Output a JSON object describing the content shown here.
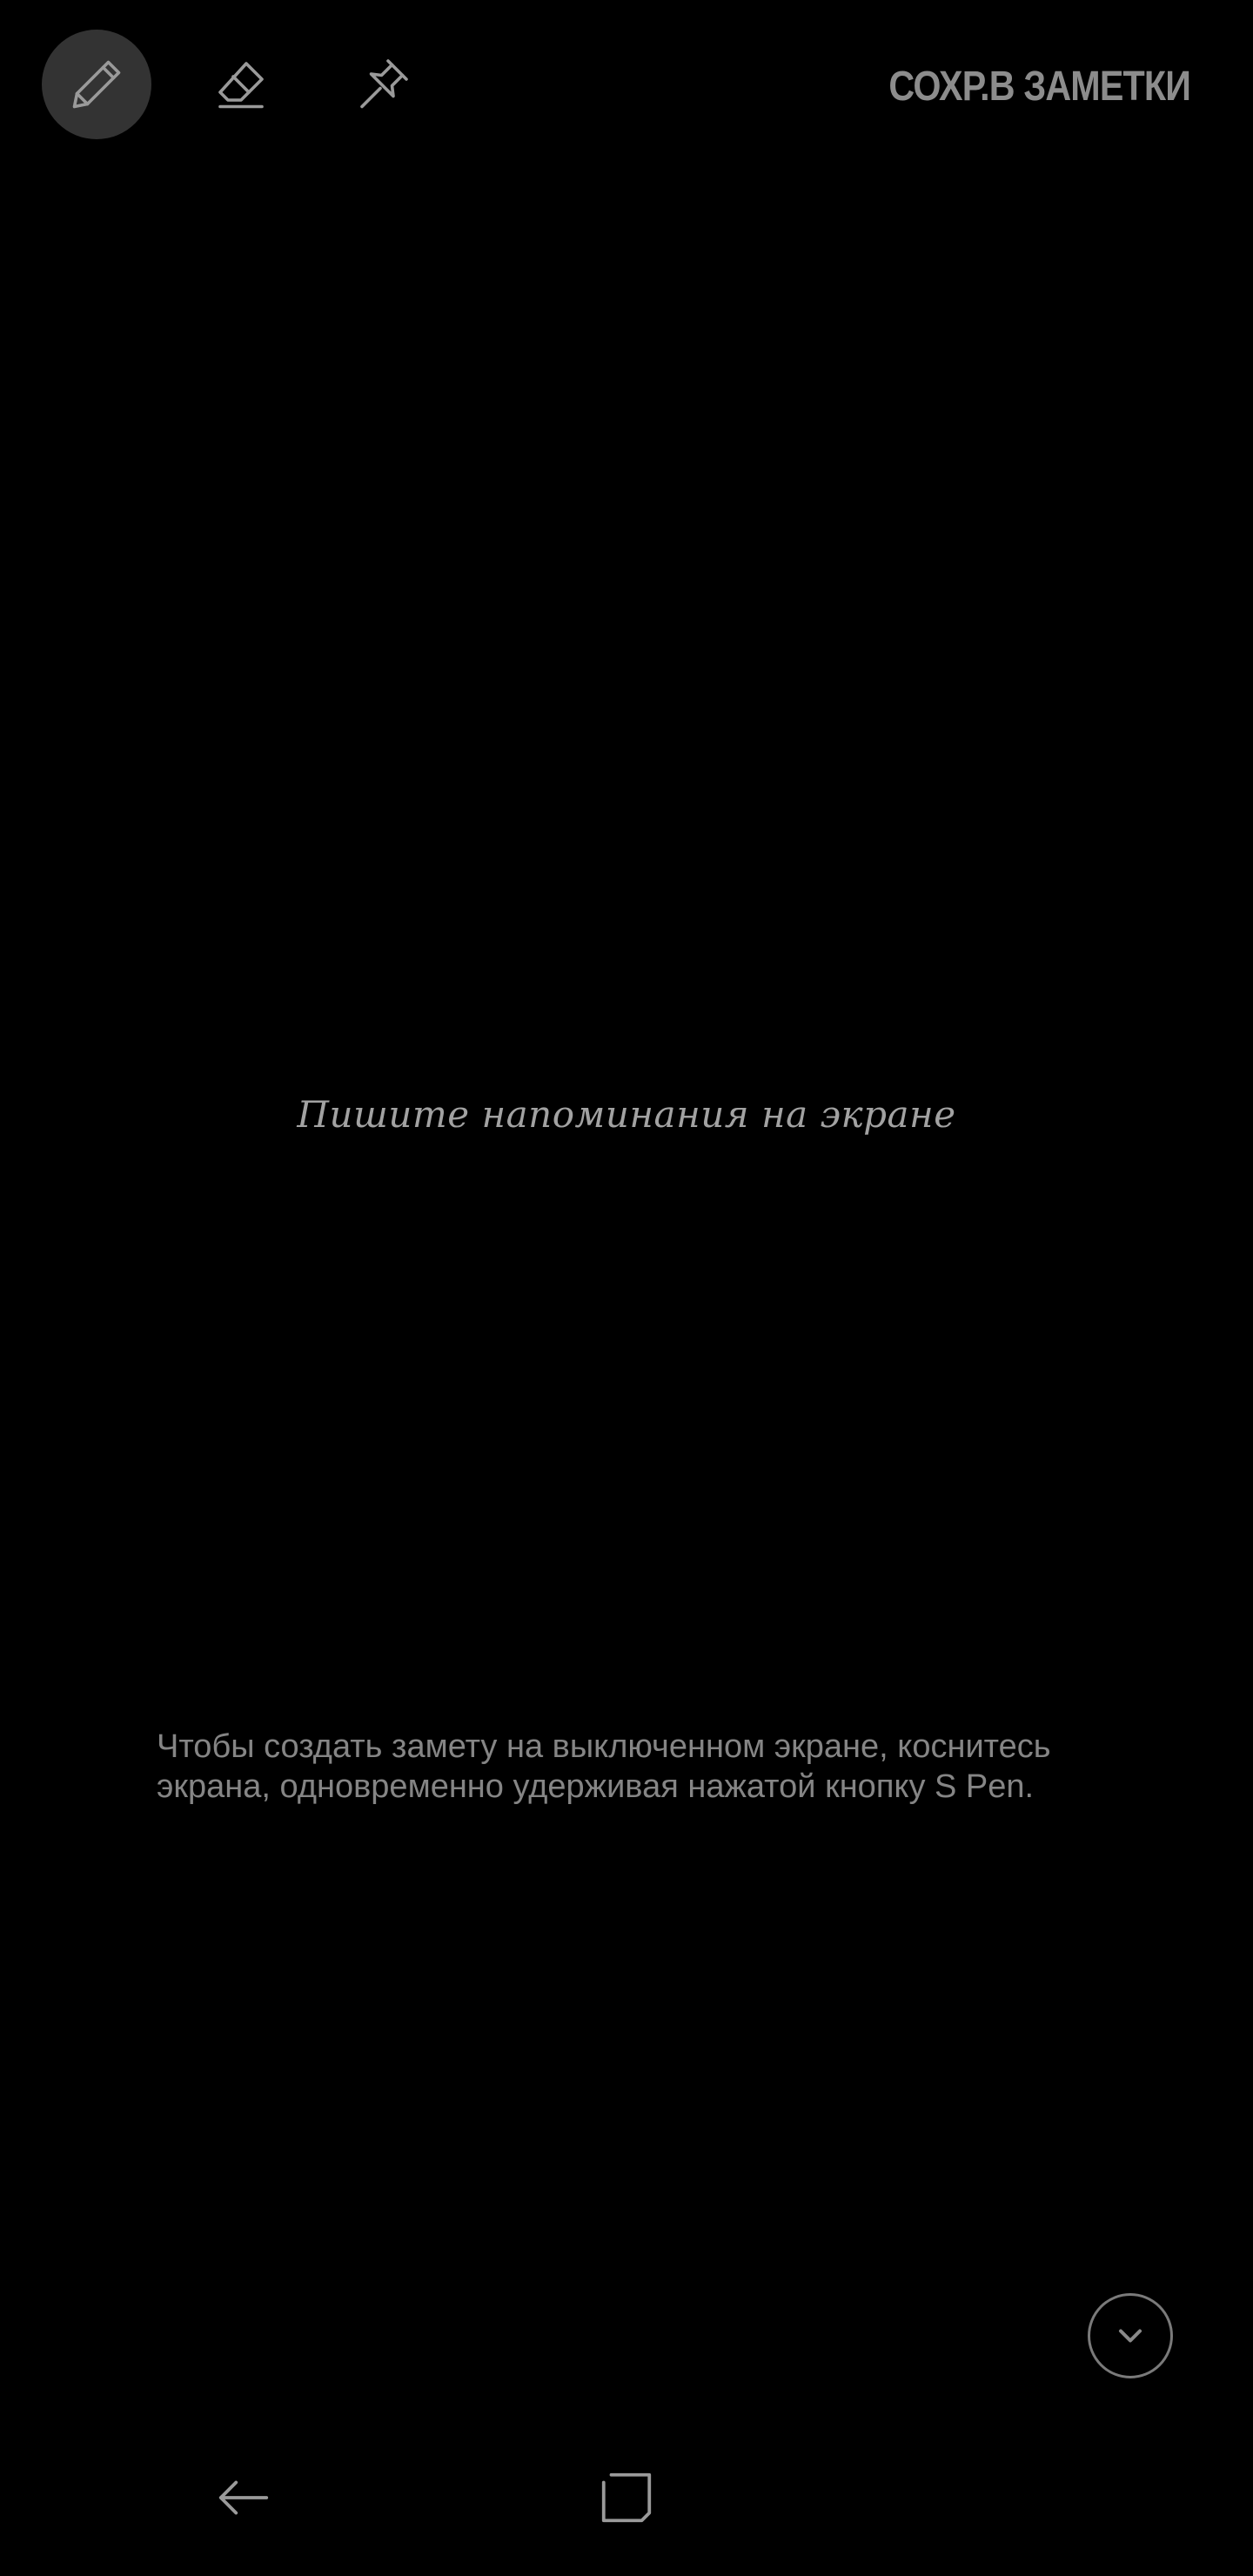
{
  "toolbar": {
    "tools": [
      {
        "name": "pen",
        "icon": "pen-icon",
        "active": true
      },
      {
        "name": "eraser",
        "icon": "eraser-icon",
        "active": false
      },
      {
        "name": "pin",
        "icon": "pin-icon",
        "active": false
      }
    ],
    "save_label": "СОХР.В ЗАМЕТКИ"
  },
  "canvas": {
    "placeholder": "Пишите напоминания на экране",
    "info": "Чтобы создать замету на выключенном экране, коснитесь экрана, одновременно удерживая нажатой кнопку S Pen."
  },
  "controls": {
    "collapse_icon": "chevron-down-icon"
  },
  "navbar": {
    "back_icon": "back-arrow-icon",
    "recents_icon": "recents-icon"
  },
  "colors": {
    "background": "#000000",
    "text": "#8c8c8c",
    "active_tool_bg": "#333333"
  }
}
